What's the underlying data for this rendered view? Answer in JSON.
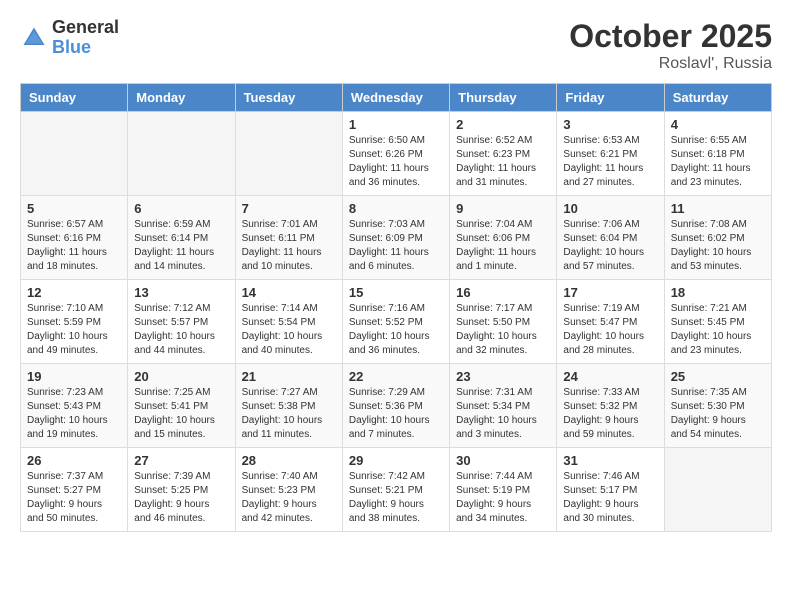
{
  "logo": {
    "general": "General",
    "blue": "Blue"
  },
  "title": "October 2025",
  "location": "Roslavl', Russia",
  "days_header": [
    "Sunday",
    "Monday",
    "Tuesday",
    "Wednesday",
    "Thursday",
    "Friday",
    "Saturday"
  ],
  "weeks": [
    [
      {
        "day": "",
        "info": ""
      },
      {
        "day": "",
        "info": ""
      },
      {
        "day": "",
        "info": ""
      },
      {
        "day": "1",
        "info": "Sunrise: 6:50 AM\nSunset: 6:26 PM\nDaylight: 11 hours\nand 36 minutes."
      },
      {
        "day": "2",
        "info": "Sunrise: 6:52 AM\nSunset: 6:23 PM\nDaylight: 11 hours\nand 31 minutes."
      },
      {
        "day": "3",
        "info": "Sunrise: 6:53 AM\nSunset: 6:21 PM\nDaylight: 11 hours\nand 27 minutes."
      },
      {
        "day": "4",
        "info": "Sunrise: 6:55 AM\nSunset: 6:18 PM\nDaylight: 11 hours\nand 23 minutes."
      }
    ],
    [
      {
        "day": "5",
        "info": "Sunrise: 6:57 AM\nSunset: 6:16 PM\nDaylight: 11 hours\nand 18 minutes."
      },
      {
        "day": "6",
        "info": "Sunrise: 6:59 AM\nSunset: 6:14 PM\nDaylight: 11 hours\nand 14 minutes."
      },
      {
        "day": "7",
        "info": "Sunrise: 7:01 AM\nSunset: 6:11 PM\nDaylight: 11 hours\nand 10 minutes."
      },
      {
        "day": "8",
        "info": "Sunrise: 7:03 AM\nSunset: 6:09 PM\nDaylight: 11 hours\nand 6 minutes."
      },
      {
        "day": "9",
        "info": "Sunrise: 7:04 AM\nSunset: 6:06 PM\nDaylight: 11 hours\nand 1 minute."
      },
      {
        "day": "10",
        "info": "Sunrise: 7:06 AM\nSunset: 6:04 PM\nDaylight: 10 hours\nand 57 minutes."
      },
      {
        "day": "11",
        "info": "Sunrise: 7:08 AM\nSunset: 6:02 PM\nDaylight: 10 hours\nand 53 minutes."
      }
    ],
    [
      {
        "day": "12",
        "info": "Sunrise: 7:10 AM\nSunset: 5:59 PM\nDaylight: 10 hours\nand 49 minutes."
      },
      {
        "day": "13",
        "info": "Sunrise: 7:12 AM\nSunset: 5:57 PM\nDaylight: 10 hours\nand 44 minutes."
      },
      {
        "day": "14",
        "info": "Sunrise: 7:14 AM\nSunset: 5:54 PM\nDaylight: 10 hours\nand 40 minutes."
      },
      {
        "day": "15",
        "info": "Sunrise: 7:16 AM\nSunset: 5:52 PM\nDaylight: 10 hours\nand 36 minutes."
      },
      {
        "day": "16",
        "info": "Sunrise: 7:17 AM\nSunset: 5:50 PM\nDaylight: 10 hours\nand 32 minutes."
      },
      {
        "day": "17",
        "info": "Sunrise: 7:19 AM\nSunset: 5:47 PM\nDaylight: 10 hours\nand 28 minutes."
      },
      {
        "day": "18",
        "info": "Sunrise: 7:21 AM\nSunset: 5:45 PM\nDaylight: 10 hours\nand 23 minutes."
      }
    ],
    [
      {
        "day": "19",
        "info": "Sunrise: 7:23 AM\nSunset: 5:43 PM\nDaylight: 10 hours\nand 19 minutes."
      },
      {
        "day": "20",
        "info": "Sunrise: 7:25 AM\nSunset: 5:41 PM\nDaylight: 10 hours\nand 15 minutes."
      },
      {
        "day": "21",
        "info": "Sunrise: 7:27 AM\nSunset: 5:38 PM\nDaylight: 10 hours\nand 11 minutes."
      },
      {
        "day": "22",
        "info": "Sunrise: 7:29 AM\nSunset: 5:36 PM\nDaylight: 10 hours\nand 7 minutes."
      },
      {
        "day": "23",
        "info": "Sunrise: 7:31 AM\nSunset: 5:34 PM\nDaylight: 10 hours\nand 3 minutes."
      },
      {
        "day": "24",
        "info": "Sunrise: 7:33 AM\nSunset: 5:32 PM\nDaylight: 9 hours\nand 59 minutes."
      },
      {
        "day": "25",
        "info": "Sunrise: 7:35 AM\nSunset: 5:30 PM\nDaylight: 9 hours\nand 54 minutes."
      }
    ],
    [
      {
        "day": "26",
        "info": "Sunrise: 7:37 AM\nSunset: 5:27 PM\nDaylight: 9 hours\nand 50 minutes."
      },
      {
        "day": "27",
        "info": "Sunrise: 7:39 AM\nSunset: 5:25 PM\nDaylight: 9 hours\nand 46 minutes."
      },
      {
        "day": "28",
        "info": "Sunrise: 7:40 AM\nSunset: 5:23 PM\nDaylight: 9 hours\nand 42 minutes."
      },
      {
        "day": "29",
        "info": "Sunrise: 7:42 AM\nSunset: 5:21 PM\nDaylight: 9 hours\nand 38 minutes."
      },
      {
        "day": "30",
        "info": "Sunrise: 7:44 AM\nSunset: 5:19 PM\nDaylight: 9 hours\nand 34 minutes."
      },
      {
        "day": "31",
        "info": "Sunrise: 7:46 AM\nSunset: 5:17 PM\nDaylight: 9 hours\nand 30 minutes."
      },
      {
        "day": "",
        "info": ""
      }
    ]
  ]
}
